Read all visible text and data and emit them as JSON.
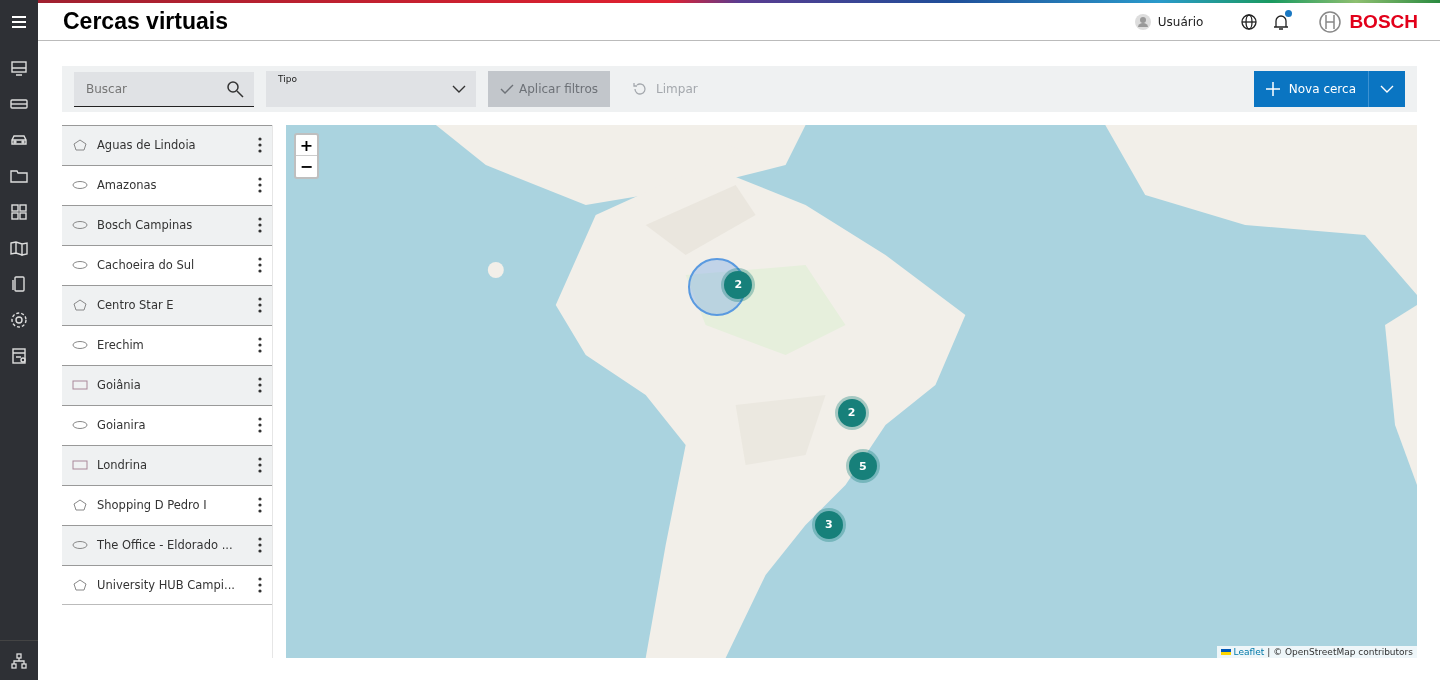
{
  "header": {
    "title": "Cercas virtuais",
    "user": "Usuário",
    "brand": "BOSCH",
    "notification": true
  },
  "filters": {
    "search": {
      "placeholder": "Buscar"
    },
    "type": {
      "label": "Tipo"
    },
    "apply": {
      "label": "Aplicar filtros",
      "disabled": true
    },
    "clear": {
      "label": "Limpar",
      "disabled": true
    },
    "new": {
      "label": "Nova cerca"
    }
  },
  "fences": [
    {
      "name": "Aguas de Lindoia",
      "kind": "polygon"
    },
    {
      "name": "Amazonas",
      "kind": "ellipse"
    },
    {
      "name": "Bosch Campinas",
      "kind": "ellipse"
    },
    {
      "name": "Cachoeira do Sul",
      "kind": "ellipse"
    },
    {
      "name": "Centro Star E",
      "kind": "polygon"
    },
    {
      "name": "Erechim",
      "kind": "ellipse"
    },
    {
      "name": "Goiânia",
      "kind": "rectangle"
    },
    {
      "name": "Goianira",
      "kind": "ellipse"
    },
    {
      "name": "Londrina",
      "kind": "rectangle"
    },
    {
      "name": "Shopping D Pedro I",
      "kind": "polygon"
    },
    {
      "name": "The Office - Eldorado ...",
      "kind": "ellipse"
    },
    {
      "name": "University HUB Campi...",
      "kind": "polygon"
    }
  ],
  "map": {
    "zoom_in": "+",
    "zoom_out": "−",
    "clusters": [
      {
        "count": "2",
        "expanded": true
      },
      {
        "count": "2",
        "expanded": false
      },
      {
        "count": "5",
        "expanded": false
      },
      {
        "count": "3",
        "expanded": false
      }
    ],
    "attribution_link": "Leaflet",
    "attribution": "| © OpenStreetMap contributors"
  }
}
